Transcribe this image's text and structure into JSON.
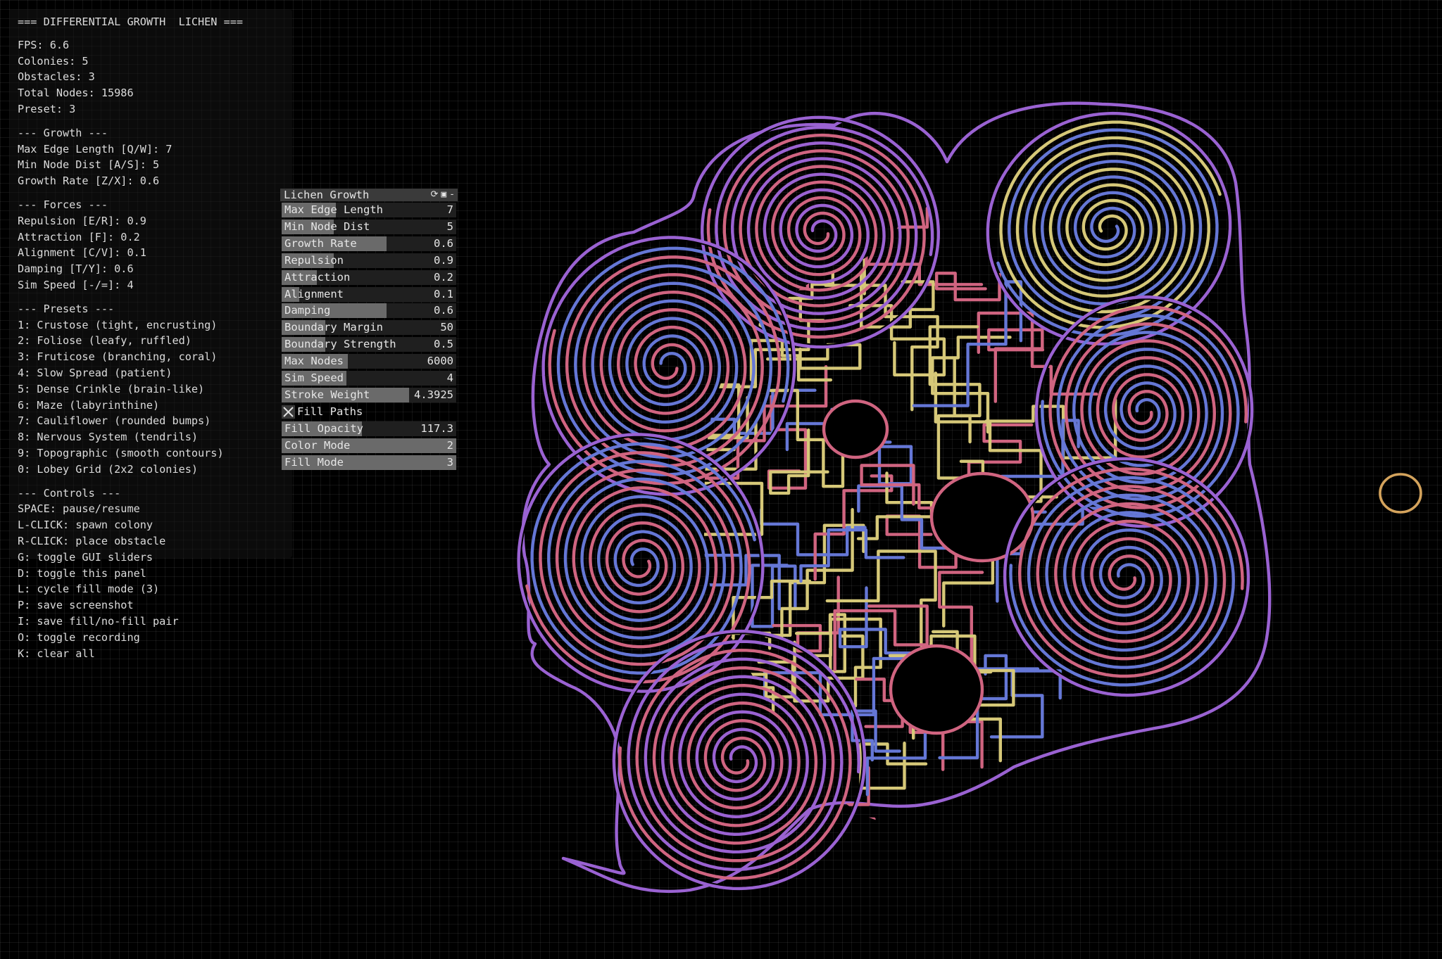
{
  "info_panel": {
    "title": "=== DIFFERENTIAL GROWTH  LICHEN ===",
    "stats": [
      "FPS: 6.6",
      "Colonies: 5",
      "Obstacles: 3",
      "Total Nodes: 15986",
      "Preset: 3"
    ],
    "growth_header": "--- Growth ---",
    "growth": [
      "Max Edge Length [Q/W]: 7",
      "Min Node Dist [A/S]: 5",
      "Growth Rate [Z/X]: 0.6"
    ],
    "forces_header": "--- Forces ---",
    "forces": [
      "Repulsion [E/R]: 0.9",
      "Attraction [F]: 0.2",
      "Alignment [C/V]: 0.1",
      "Damping [T/Y]: 0.6",
      "Sim Speed [-/=]: 4"
    ],
    "presets_header": "--- Presets ---",
    "presets": [
      "1: Crustose (tight, encrusting)",
      "2: Foliose (leafy, ruffled)",
      "3: Fruticose (branching, coral)",
      "4: Slow Spread (patient)",
      "5: Dense Crinkle (brain-like)",
      "6: Maze (labyrinthine)",
      "7: Cauliflower (rounded bumps)",
      "8: Nervous System (tendrils)",
      "9: Topographic (smooth contours)",
      "0: Lobey Grid (2x2 colonies)"
    ],
    "controls_header": "--- Controls ---",
    "controls": [
      "SPACE: pause/resume",
      "L-CLICK: spawn colony",
      "R-CLICK: place obstacle",
      "G: toggle GUI sliders",
      "D: toggle this panel",
      "L: cycle fill mode (3)",
      "P: save screenshot",
      "I: save fill/no-fill pair",
      "O: toggle recording",
      "K: clear all"
    ]
  },
  "gui": {
    "title": "Lichen Growth",
    "header_icons": [
      "refresh-icon",
      "save-icon",
      "collapse-icon"
    ],
    "header_glyphs": [
      "⟳",
      "▣",
      "-"
    ],
    "sliders": [
      {
        "label": "Max Edge Length",
        "value": "7",
        "fraction": 0.31
      },
      {
        "label": "Min Node Dist",
        "value": "5",
        "fraction": 0.3
      },
      {
        "label": "Growth Rate",
        "value": "0.6",
        "fraction": 0.6
      },
      {
        "label": "Repulsion",
        "value": "0.9",
        "fraction": 0.3
      },
      {
        "label": "Attraction",
        "value": "0.2",
        "fraction": 0.2
      },
      {
        "label": "Alignment",
        "value": "0.1",
        "fraction": 0.1
      },
      {
        "label": "Damping",
        "value": "0.6",
        "fraction": 0.6
      },
      {
        "label": "Boundary Margin",
        "value": "50",
        "fraction": 0.25
      },
      {
        "label": "Boundary Strength",
        "value": "0.5",
        "fraction": 0.25
      },
      {
        "label": "Max Nodes",
        "value": "6000",
        "fraction": 0.38
      },
      {
        "label": "Sim Speed",
        "value": "4",
        "fraction": 0.37
      },
      {
        "label": "Stroke Weight",
        "value": "4.3925",
        "fraction": 0.73
      }
    ],
    "toggle": {
      "label": "Fill Paths",
      "checked": true
    },
    "sliders2": [
      {
        "label": "Fill Opacity",
        "value": "117.3",
        "fraction": 0.46
      },
      {
        "label": "Color Mode",
        "value": "2",
        "fraction": 1.0
      },
      {
        "label": "Fill Mode",
        "value": "3",
        "fraction": 1.0
      }
    ]
  },
  "palette": {
    "pink": "#d06480",
    "violet": "#9a62d2",
    "blue": "#6577d6",
    "yellow": "#d6c878",
    "obstacle": "#d4a35c",
    "grid": "#141414",
    "background": "#000000"
  }
}
